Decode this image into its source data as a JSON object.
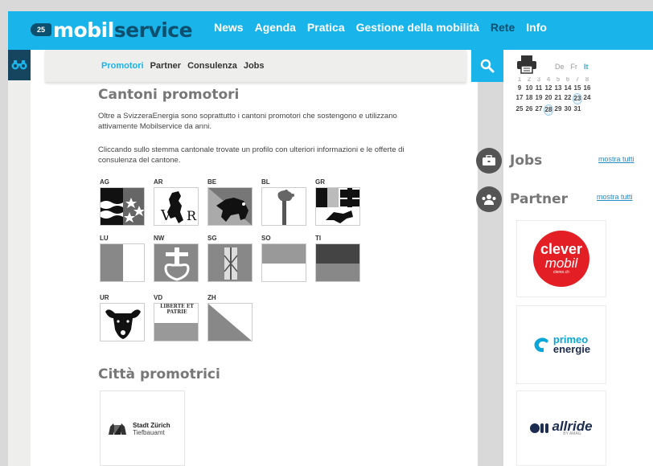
{
  "header": {
    "logo_badge": "25",
    "logo_part1": "mobil",
    "logo_part2": "service",
    "nav": [
      {
        "label": "News",
        "active": false
      },
      {
        "label": "Agenda",
        "active": false
      },
      {
        "label": "Pratica",
        "active": false
      },
      {
        "label": "Gestione della mobilità",
        "active": false
      },
      {
        "label": "Rete",
        "active": true
      },
      {
        "label": "Info",
        "active": false
      }
    ]
  },
  "subnav": [
    {
      "label": "Promotori",
      "active": true
    },
    {
      "label": "Partner",
      "active": false
    },
    {
      "label": "Consulenza",
      "active": false
    },
    {
      "label": "Jobs",
      "active": false
    }
  ],
  "icons": {
    "rail": "binoculars-icon",
    "search": "search-icon",
    "print": "printer-icon",
    "jobs": "briefcase-icon",
    "partner": "users-icon"
  },
  "languages": [
    {
      "label": "De",
      "active": false
    },
    {
      "label": "Fr",
      "active": false
    },
    {
      "label": "It",
      "active": true
    }
  ],
  "calendar": {
    "rows": [
      [
        "1",
        "2",
        "3",
        "4",
        "5",
        "6",
        "7",
        "8"
      ],
      [
        "9",
        "10",
        "11",
        "12",
        "13",
        "14",
        "15",
        "16"
      ],
      [
        "17",
        "18",
        "19",
        "20",
        "21",
        "22",
        "23",
        "24"
      ],
      [
        "25",
        "26",
        "27",
        "28",
        "29",
        "30",
        "31"
      ]
    ],
    "highlighted": [
      "23",
      "28"
    ]
  },
  "sidebar": {
    "jobs_title": "Jobs",
    "jobs_link": "mostra tutti",
    "partner_title": "Partner",
    "partner_link": "mostra tutti",
    "partners": [
      {
        "name": "clever",
        "name2": "mobil",
        "sub": "clemo.ch"
      },
      {
        "name": "primeo",
        "name2": "energie"
      },
      {
        "name": "allride",
        "sub": "BY AMAG"
      }
    ]
  },
  "main": {
    "title": "Cantoni promotori",
    "intro": "Oltre a SvizzeraEnergia sono soprattutto i cantoni promotori che sostengono e utilizzano attivamente Mobilservice da anni.",
    "instructions": "Cliccando sullo stemma cantonale trovate un profilo con ulteriori informazioni e le offerte di consulenza del cantone.",
    "cantons": [
      {
        "code": "AG"
      },
      {
        "code": "AR"
      },
      {
        "code": "BE"
      },
      {
        "code": "BL"
      },
      {
        "code": "GR"
      },
      {
        "code": "LU"
      },
      {
        "code": "NW"
      },
      {
        "code": "SG"
      },
      {
        "code": "SO"
      },
      {
        "code": "TI"
      },
      {
        "code": "UR"
      },
      {
        "code": "VD",
        "motto": "LIBERTÉ ET PATRIE"
      },
      {
        "code": "ZH"
      }
    ],
    "cities_title": "Città promotrici",
    "city": {
      "name": "Stadt Zürich",
      "department": "Tiefbauamt"
    }
  },
  "colors": {
    "brand_blue": "#18b4ea",
    "brand_dark": "#0d4f6e",
    "clever_red": "#e31e24",
    "primeo_blue": "#0aa5d9",
    "allride_navy": "#1c2d4f"
  }
}
